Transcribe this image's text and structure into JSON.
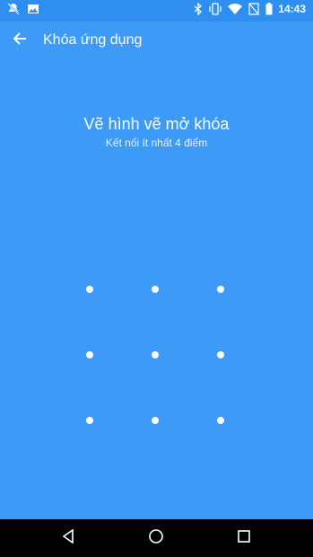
{
  "status_bar": {
    "time": "14:43",
    "left_icons": [
      "notification-muted-icon",
      "image-icon"
    ],
    "right_icons": [
      "bluetooth-icon",
      "vibrate-icon",
      "wifi-icon",
      "signal-off-icon",
      "battery-icon"
    ]
  },
  "app_bar": {
    "title": "Khóa ứng dụng",
    "back_icon": "arrow-left-icon"
  },
  "pattern": {
    "title": "Vẽ hình vẽ mở khóa",
    "hint": "Kết nối ít nhất 4 điểm",
    "grid_size": 3
  },
  "nav_bar": {
    "buttons": [
      "back-triangle-icon",
      "home-circle-icon",
      "recents-square-icon"
    ]
  },
  "colors": {
    "background": "#3d9bf7",
    "status_bar": "#2f8ff0",
    "nav_bar": "#000000",
    "foreground": "#ffffff"
  }
}
